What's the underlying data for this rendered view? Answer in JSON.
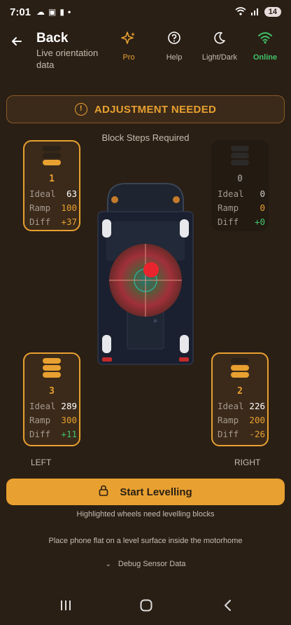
{
  "status": {
    "time": "7:01",
    "battery": "14"
  },
  "header": {
    "back_label": "Back",
    "subtitle": "Live orientation data",
    "pro_label": "Pro",
    "help_label": "Help",
    "theme_label": "Light/Dark",
    "online_label": "Online"
  },
  "banner": {
    "text": "ADJUSTMENT NEEDED"
  },
  "steps_title": "Block Steps Required",
  "wheels": {
    "front_left": {
      "blocks": "1",
      "ideal": "63",
      "ramp": "100",
      "diff": "+37"
    },
    "front_right": {
      "blocks": "0",
      "ideal": "0",
      "ramp": "0",
      "diff": "+0"
    },
    "rear_left": {
      "blocks": "3",
      "ideal": "289",
      "ramp": "300",
      "diff": "+11"
    },
    "rear_right": {
      "blocks": "2",
      "ideal": "226",
      "ramp": "200",
      "diff": "-26"
    }
  },
  "labels": {
    "ideal": "Ideal",
    "ramp": "Ramp",
    "diff": "Diff",
    "left": "LEFT",
    "right": "RIGHT"
  },
  "actions": {
    "start": "Start Levelling"
  },
  "notes": {
    "highlighted": "Highlighted wheels need levelling blocks",
    "place": "Place phone flat on a level surface inside the motorhome",
    "debug": "Debug Sensor Data"
  },
  "colors": {
    "accent": "#e8a030",
    "online": "#3fc46a",
    "background": "#2a1f15"
  }
}
